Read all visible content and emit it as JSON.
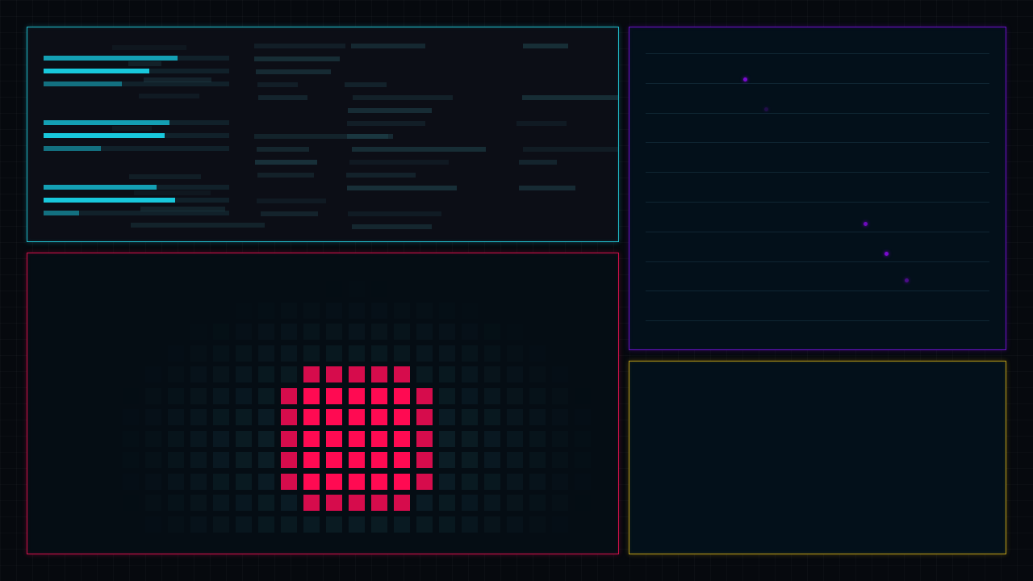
{
  "theme": {
    "background": "#06090e",
    "cyan": "#18c8dc",
    "magenta": "#ff0a52",
    "purple": "#7a0ad0",
    "gold": "#c8a020",
    "teal_dim": "#1e3840"
  },
  "panels": {
    "bars_panel": {
      "border_color": "#1fb8c8"
    },
    "grid_panel": {
      "border_color": "#d0104a"
    },
    "scatter_panel": {
      "border_color": "#6a10c8"
    },
    "empty_panel": {
      "border_color": "#b89a18"
    }
  },
  "bar_groups": [
    {
      "bars": [
        {
          "level": 0.72,
          "tone": "mid"
        },
        {
          "level": 0.57,
          "tone": "bright"
        },
        {
          "level": 0.42,
          "tone": "dim"
        }
      ]
    },
    {
      "bars": [
        {
          "level": 0.68,
          "tone": "mid"
        },
        {
          "level": 0.65,
          "tone": "bright"
        },
        {
          "level": 0.31,
          "tone": "dim"
        }
      ]
    },
    {
      "bars": [
        {
          "level": 0.61,
          "tone": "mid"
        },
        {
          "level": 0.71,
          "tone": "bright"
        },
        {
          "level": 0.19,
          "tone": "dim"
        }
      ]
    }
  ],
  "heat_grid": {
    "rows": 12,
    "cols": 24,
    "active_cells": [
      [
        4,
        11
      ],
      [
        4,
        12
      ],
      [
        4,
        13
      ],
      [
        4,
        14
      ],
      [
        4,
        15
      ],
      [
        5,
        10
      ],
      [
        5,
        11
      ],
      [
        5,
        12
      ],
      [
        5,
        13
      ],
      [
        5,
        14
      ],
      [
        5,
        15
      ],
      [
        5,
        16
      ],
      [
        6,
        10
      ],
      [
        6,
        11
      ],
      [
        6,
        12
      ],
      [
        6,
        13
      ],
      [
        6,
        14
      ],
      [
        6,
        15
      ],
      [
        6,
        16
      ],
      [
        7,
        10
      ],
      [
        7,
        11
      ],
      [
        7,
        12
      ],
      [
        7,
        13
      ],
      [
        7,
        14
      ],
      [
        7,
        15
      ],
      [
        7,
        16
      ],
      [
        8,
        10
      ],
      [
        8,
        11
      ],
      [
        8,
        12
      ],
      [
        8,
        13
      ],
      [
        8,
        14
      ],
      [
        8,
        15
      ],
      [
        8,
        16
      ],
      [
        9,
        10
      ],
      [
        9,
        11
      ],
      [
        9,
        12
      ],
      [
        9,
        13
      ],
      [
        9,
        14
      ],
      [
        9,
        15
      ],
      [
        9,
        16
      ],
      [
        10,
        11
      ],
      [
        10,
        12
      ],
      [
        10,
        13
      ],
      [
        10,
        14
      ],
      [
        10,
        15
      ]
    ]
  },
  "scatter": {
    "lines": 10,
    "points": [
      {
        "x": 0.29,
        "y": 0.09,
        "alpha": 1.0
      },
      {
        "x": 0.35,
        "y": 0.19,
        "alpha": 0.25
      },
      {
        "x": 0.64,
        "y": 0.58,
        "alpha": 0.9
      },
      {
        "x": 0.7,
        "y": 0.68,
        "alpha": 1.0
      },
      {
        "x": 0.76,
        "y": 0.77,
        "alpha": 0.6
      }
    ]
  }
}
